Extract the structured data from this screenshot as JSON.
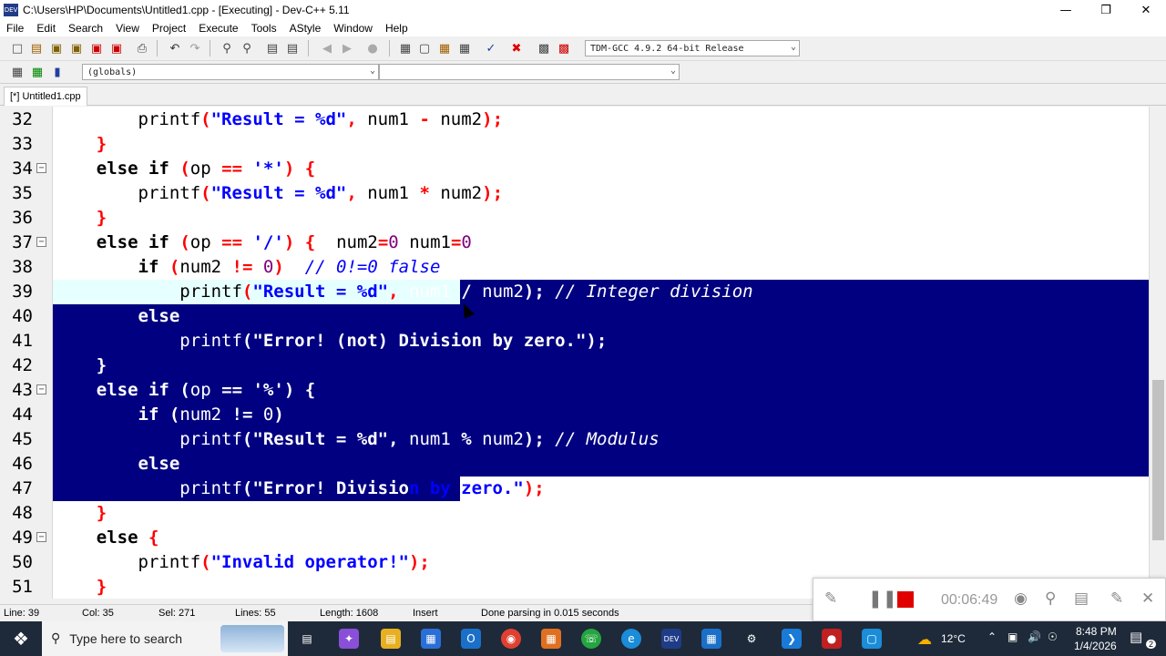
{
  "window": {
    "title": "C:\\Users\\HP\\Documents\\Untitled1.cpp - [Executing] - Dev-C++ 5.11",
    "app_icon_text": "DEV"
  },
  "menu": [
    "File",
    "Edit",
    "Search",
    "View",
    "Project",
    "Execute",
    "Tools",
    "AStyle",
    "Window",
    "Help"
  ],
  "toolbar": {
    "compiler": "TDM-GCC 4.9.2 64-bit Release",
    "scope": "(globals)",
    "symbol": ""
  },
  "tab": {
    "label": "[*] Untitled1.cpp"
  },
  "code_lines": [
    {
      "num": "32",
      "fold": false,
      "text": "        printf(\"Result = %d\", num1 - num2);"
    },
    {
      "num": "33",
      "fold": false,
      "text": "    }"
    },
    {
      "num": "34",
      "fold": true,
      "text": "    else if (op == '*') {"
    },
    {
      "num": "35",
      "fold": false,
      "text": "        printf(\"Result = %d\", num1 * num2);"
    },
    {
      "num": "36",
      "fold": false,
      "text": "    }"
    },
    {
      "num": "37",
      "fold": true,
      "text": "    else if (op == '/') {  num2=0 num1=0"
    },
    {
      "num": "38",
      "fold": false,
      "text": "        if (num2 != 0)  // 0!=0 false"
    },
    {
      "num": "39",
      "fold": false,
      "text": "            printf(\"Result = %d\", num1 / num2); // Integer division"
    },
    {
      "num": "40",
      "fold": false,
      "text": "        else"
    },
    {
      "num": "41",
      "fold": false,
      "text": "            printf(\"Error! (not) Division by zero.\");"
    },
    {
      "num": "42",
      "fold": false,
      "text": "    }"
    },
    {
      "num": "43",
      "fold": true,
      "text": "    else if (op == '%') {"
    },
    {
      "num": "44",
      "fold": false,
      "text": "        if (num2 != 0)"
    },
    {
      "num": "45",
      "fold": false,
      "text": "            printf(\"Result = %d\", num1 % num2); // Modulus"
    },
    {
      "num": "46",
      "fold": false,
      "text": "        else"
    },
    {
      "num": "47",
      "fold": false,
      "text": "            printf(\"Error! Division by zero.\");"
    },
    {
      "num": "48",
      "fold": false,
      "text": "    }"
    },
    {
      "num": "49",
      "fold": true,
      "text": "    else {"
    },
    {
      "num": "50",
      "fold": false,
      "text": "        printf(\"Invalid operator!\");"
    },
    {
      "num": "51",
      "fold": false,
      "text": "    }"
    }
  ],
  "status": {
    "line": "Line:   39",
    "col": "Col:   35",
    "sel": "Sel:   271",
    "lines": "Lines:   55",
    "length": "Length:   1608",
    "mode": "Insert",
    "message": "Done parsing in 0.015 seconds"
  },
  "recorder": {
    "timer": "00:06:49"
  },
  "taskbar": {
    "search_placeholder": "Type here to search",
    "temperature": "12°C",
    "time": "8:48 PM",
    "date": "1/4/2026",
    "notifications": "2"
  },
  "colors": {
    "selection": "#000080",
    "keyword": "#000000",
    "string": "#0000ff",
    "number_symbol": "#ff0000",
    "comment": "#0000ff"
  }
}
